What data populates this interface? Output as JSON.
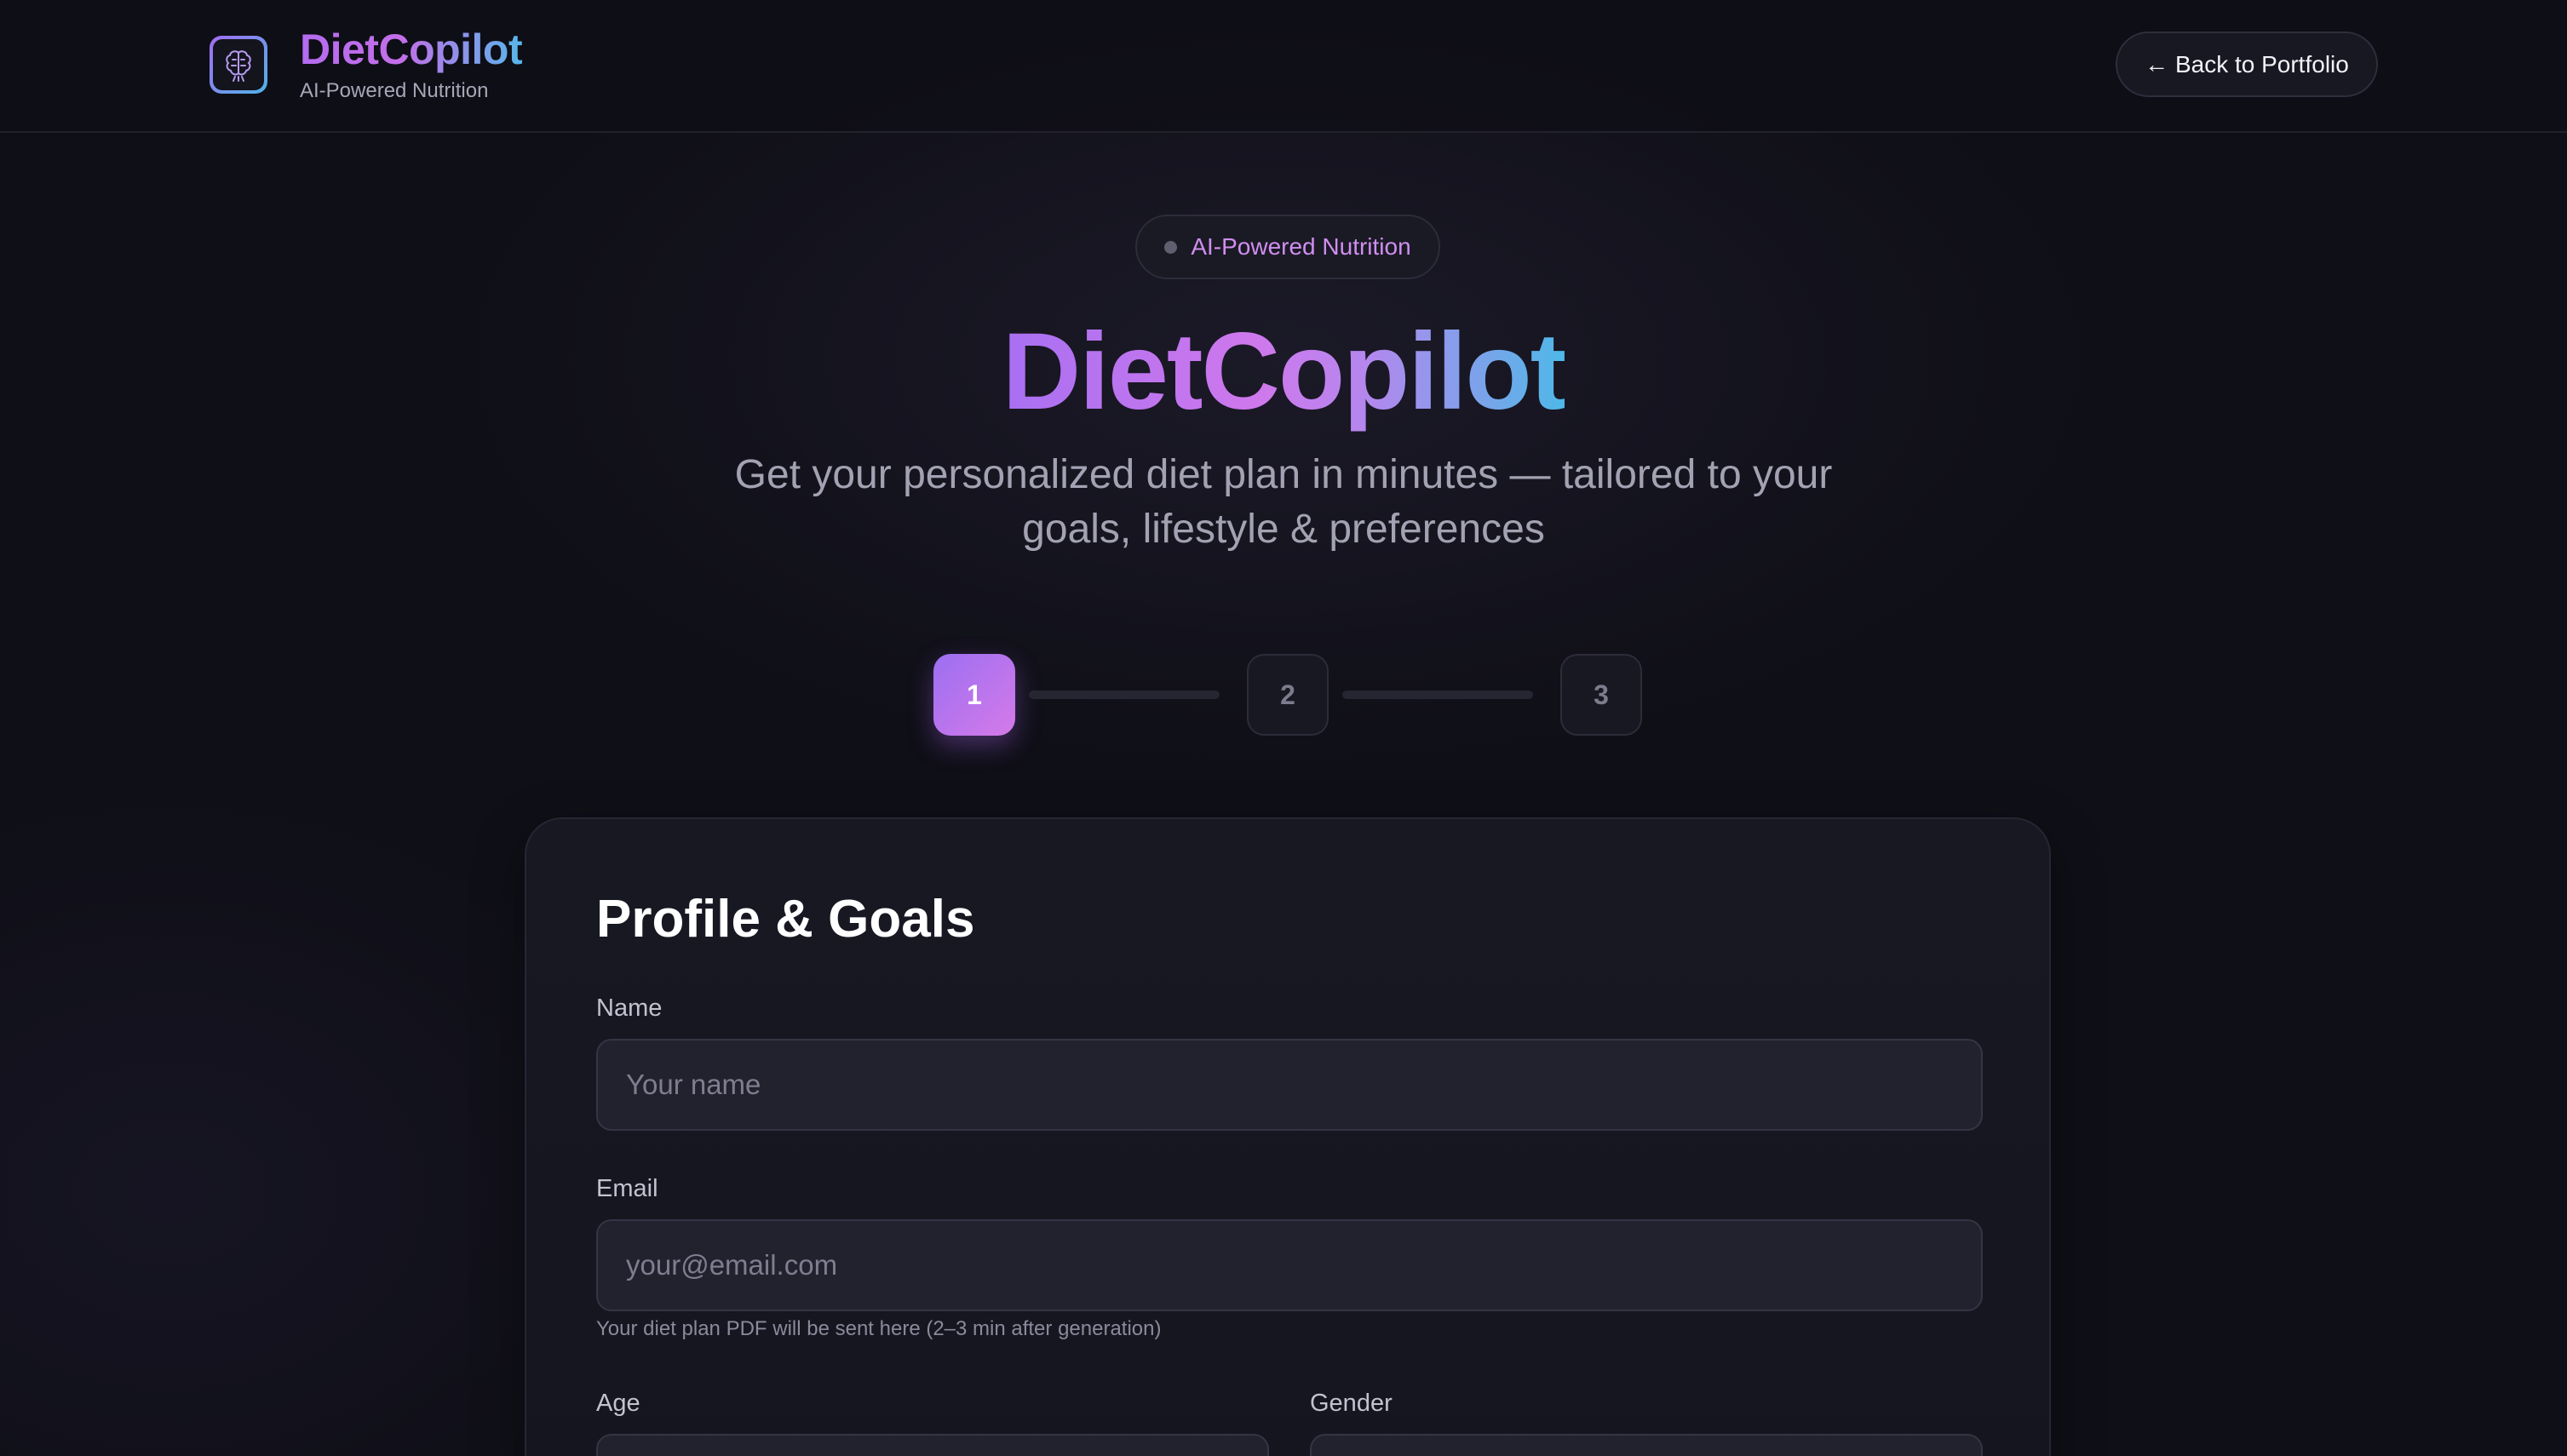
{
  "header": {
    "brand_name": "DietCopilot",
    "brand_tagline": "AI-Powered Nutrition",
    "back_button": "← Back to Portfolio"
  },
  "hero": {
    "badge": "AI-Powered Nutrition",
    "title": "DietCopilot",
    "subtitle": "Get your personalized diet plan in minutes — tailored to your goals, lifestyle & preferences"
  },
  "stepper": {
    "steps": [
      "1",
      "2",
      "3"
    ],
    "active_step": 1
  },
  "form": {
    "title": "Profile & Goals",
    "name": {
      "label": "Name",
      "placeholder": "Your name",
      "value": ""
    },
    "email": {
      "label": "Email",
      "placeholder": "your@email.com",
      "value": "",
      "hint": "Your diet plan PDF will be sent here (2–3 min after generation)"
    },
    "age": {
      "label": "Age"
    },
    "gender": {
      "label": "Gender"
    }
  },
  "colors": {
    "background": "#0f0f17",
    "accent_purple": "#a870f2",
    "accent_pink": "#d57ae8",
    "accent_blue": "#4fb8e8"
  }
}
